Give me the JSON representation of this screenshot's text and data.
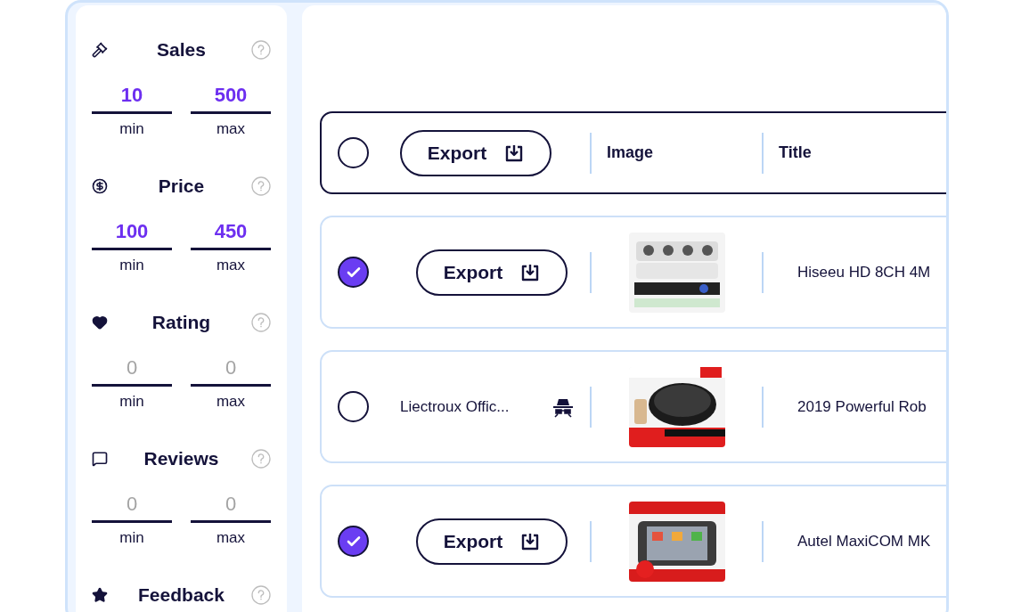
{
  "filters": [
    {
      "label": "Sales",
      "min": {
        "value": "10"
      },
      "max": {
        "value": "500"
      },
      "min_label": "min",
      "max_label": "max"
    },
    {
      "label": "Price",
      "min": {
        "value": "100"
      },
      "max": {
        "value": "450"
      },
      "min_label": "min",
      "max_label": "max"
    },
    {
      "label": "Rating",
      "min": {
        "placeholder": "0"
      },
      "max": {
        "placeholder": "0"
      },
      "min_label": "min",
      "max_label": "max"
    },
    {
      "label": "Reviews",
      "min": {
        "placeholder": "0"
      },
      "max": {
        "placeholder": "0"
      },
      "min_label": "min",
      "max_label": "max"
    },
    {
      "label": "Feedback"
    }
  ],
  "table": {
    "header": {
      "selected": false,
      "export": "Export",
      "columns": [
        "Image",
        "Title"
      ]
    },
    "rows": [
      {
        "selected": true,
        "kind": "export",
        "export": "Export",
        "title": "Hiseeu HD 8CH 4M"
      },
      {
        "selected": false,
        "kind": "seller",
        "seller": "Liectroux Offic...",
        "title": "2019 Powerful Rob"
      },
      {
        "selected": true,
        "kind": "export",
        "export": "Export",
        "title": "Autel MaxiCOM MK"
      }
    ]
  }
}
